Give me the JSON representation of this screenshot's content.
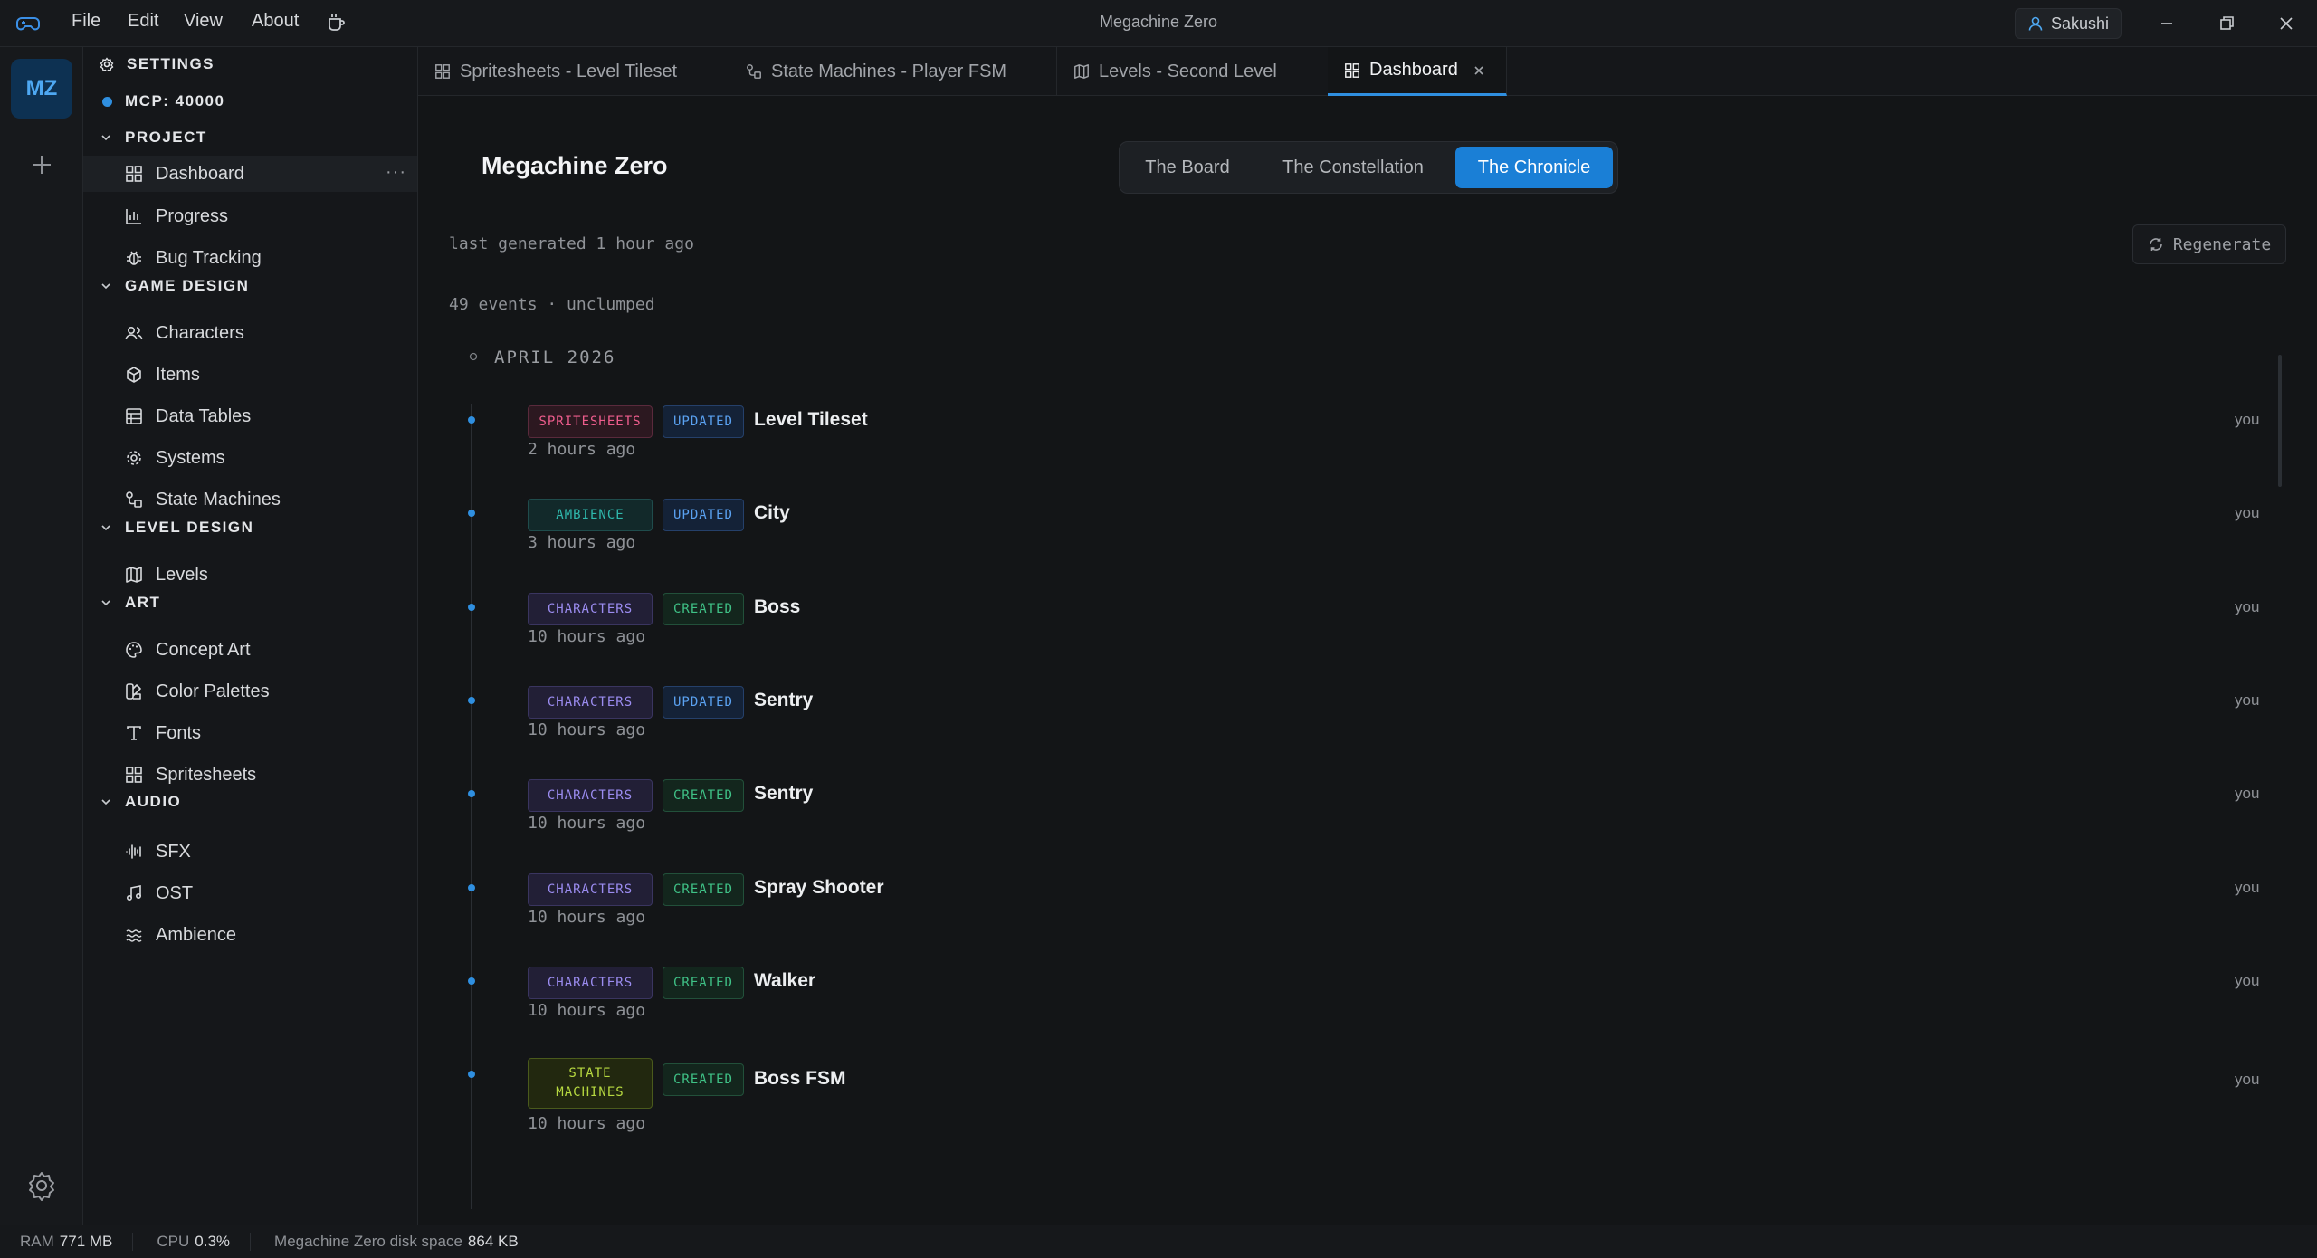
{
  "window": {
    "title": "Megachine Zero"
  },
  "menu": {
    "file": "File",
    "edit": "Edit",
    "view": "View",
    "about": "About"
  },
  "user": {
    "name": "Sakushi"
  },
  "rail": {
    "project_initials": "MZ"
  },
  "sidebar": {
    "settings": "SETTINGS",
    "mcp": "MCP: 40000",
    "project": {
      "label": "PROJECT",
      "items": [
        "Dashboard",
        "Progress",
        "Bug Tracking"
      ]
    },
    "game_design": {
      "label": "GAME DESIGN",
      "items": [
        "Characters",
        "Items",
        "Data Tables",
        "Systems",
        "State Machines"
      ]
    },
    "level_design": {
      "label": "LEVEL DESIGN",
      "items": [
        "Levels"
      ]
    },
    "art": {
      "label": "ART",
      "items": [
        "Concept Art",
        "Color Palettes",
        "Fonts",
        "Spritesheets"
      ]
    },
    "audio": {
      "label": "AUDIO",
      "items": [
        "SFX",
        "OST",
        "Ambience"
      ]
    }
  },
  "tabs": [
    "Spritesheets - Level Tileset",
    "State Machines - Player FSM",
    "Levels - Second Level",
    "Dashboard"
  ],
  "main": {
    "title": "Megachine Zero",
    "views": [
      "The Board",
      "The Constellation",
      "The Chronicle"
    ],
    "last_generated": "last generated 1 hour ago",
    "regenerate": "Regenerate",
    "event_count": "49 events · unclumped",
    "month": "APRIL 2026",
    "events": [
      {
        "category": "SPRITESHEETS",
        "action": "UPDATED",
        "title": "Level Tileset",
        "time": "2 hours ago",
        "user": "you"
      },
      {
        "category": "AMBIENCE",
        "action": "UPDATED",
        "title": "City",
        "time": "3 hours ago",
        "user": "you"
      },
      {
        "category": "CHARACTERS",
        "action": "CREATED",
        "title": "Boss",
        "time": "10 hours ago",
        "user": "you"
      },
      {
        "category": "CHARACTERS",
        "action": "UPDATED",
        "title": "Sentry",
        "time": "10 hours ago",
        "user": "you"
      },
      {
        "category": "CHARACTERS",
        "action": "CREATED",
        "title": "Sentry",
        "time": "10 hours ago",
        "user": "you"
      },
      {
        "category": "CHARACTERS",
        "action": "CREATED",
        "title": "Spray Shooter",
        "time": "10 hours ago",
        "user": "you"
      },
      {
        "category": "CHARACTERS",
        "action": "CREATED",
        "title": "Walker",
        "time": "10 hours ago",
        "user": "you"
      },
      {
        "category": "STATE MACHINES",
        "action": "CREATED",
        "title": "Boss FSM",
        "time": "10 hours ago",
        "user": "you"
      }
    ]
  },
  "status": {
    "ram_label": "RAM",
    "ram_value": "771 MB",
    "cpu_label": "CPU",
    "cpu_value": "0.3%",
    "disk_label": "Megachine Zero disk space",
    "disk_value": "864 KB"
  }
}
